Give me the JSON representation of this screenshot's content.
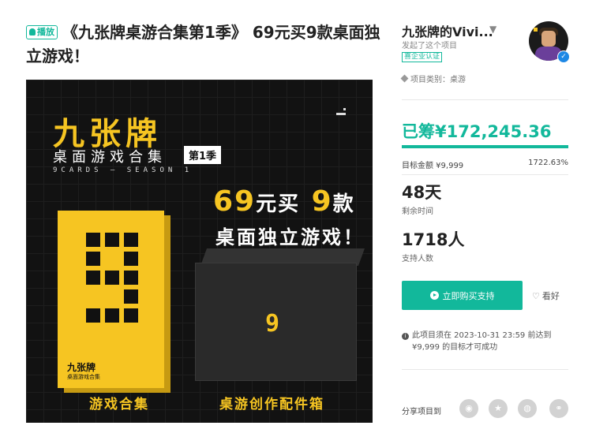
{
  "title": {
    "badge": "播放",
    "text": "《九张牌桌游合集第1季》 69元买9款桌面独立游戏！"
  },
  "hero": {
    "brand": "九张牌",
    "subtitle": "桌面游戏合集",
    "season_tag": "第1季",
    "english": "9CARDS — SEASON 1",
    "promo_price_a": "69",
    "promo_price_unit": "元买",
    "promo_count": "9",
    "promo_count_unit": "款",
    "promo_line2": "桌面独立游戏！",
    "box_label": "九张牌",
    "box_sublabel": "桌面游戏合集",
    "box_nine": "9",
    "caption_left": "游戏合集",
    "caption_right": "桌游创作配件箱"
  },
  "creator": {
    "name": "九张牌的Vivi...",
    "action": "发起了这个项目",
    "verified": "喜企业认证",
    "verify_badge": "✓"
  },
  "project": {
    "category_label": "项目类别：桌游"
  },
  "funding": {
    "raised": "已筹¥172,245.36",
    "goal": "目标金额 ¥9,999",
    "percent": "1722.63%",
    "progress_fraction": 1.0,
    "days": "48天",
    "days_label": "剩余时间",
    "backers": "1718人",
    "backers_label": "支持人数"
  },
  "actions": {
    "buy_label": "立即购买支持",
    "follow_label": "看好"
  },
  "notice": {
    "line1": "此项目须在 2023-10-31 23:59 前达到",
    "line2": "¥9,999 的目标才可成功"
  },
  "share": {
    "label": "分享项目到",
    "icons": [
      "weibo-icon",
      "star-icon",
      "wechat-icon",
      "link-icon"
    ]
  },
  "colors": {
    "accent": "#12b89b",
    "hero_yellow": "#f6c522",
    "hero_bg": "#121212"
  }
}
